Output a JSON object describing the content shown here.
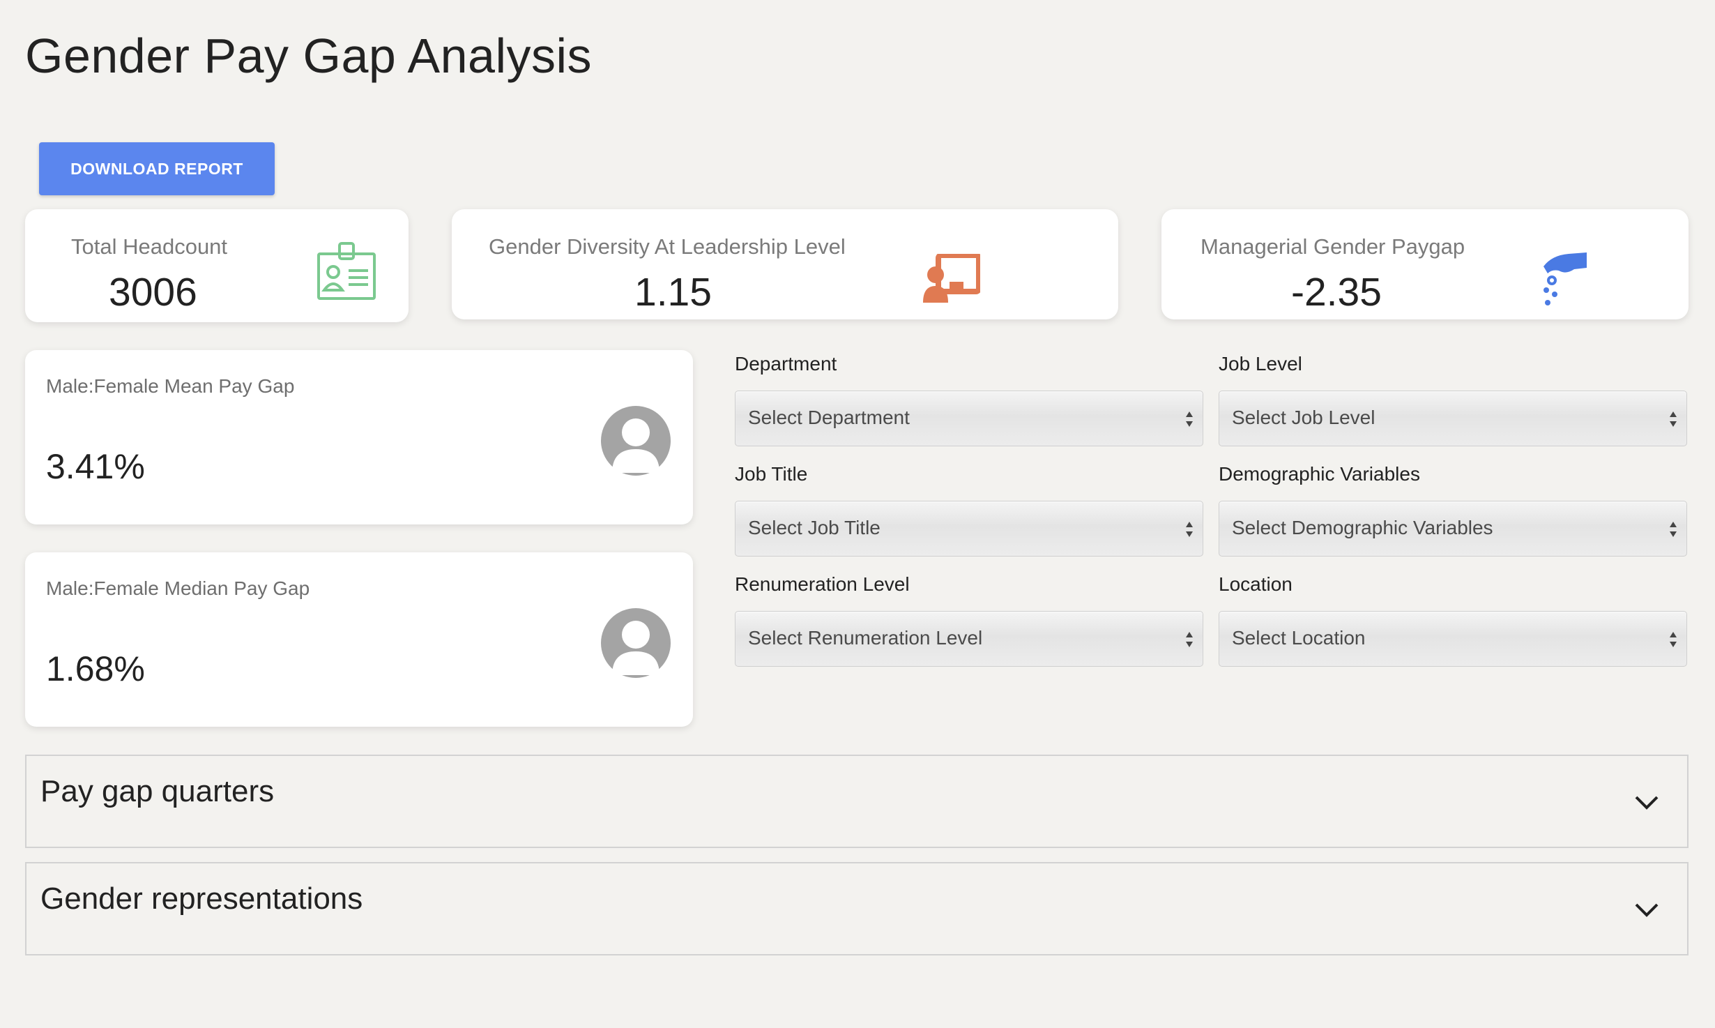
{
  "page_title": "Gender Pay Gap Analysis",
  "download_button": "DOWNLOAD REPORT",
  "stats": {
    "headcount": {
      "label": "Total Headcount",
      "value": "3006",
      "icon": "id-badge-icon",
      "color": "#7bc98f"
    },
    "diversity": {
      "label": "Gender Diversity At Leadership Level",
      "value": "1.15",
      "icon": "presenter-icon",
      "color": "#e07a52"
    },
    "paygap": {
      "label": "Managerial Gender Paygap",
      "value": "-2.35",
      "icon": "hand-coins-icon",
      "color": "#4a7ae3"
    }
  },
  "gap_cards": {
    "mean": {
      "label": "Male:Female Mean Pay Gap",
      "value": "3.41%"
    },
    "median": {
      "label": "Male:Female Median Pay Gap",
      "value": "1.68%"
    }
  },
  "filters": {
    "department": {
      "label": "Department",
      "placeholder": "Select Department"
    },
    "job_level": {
      "label": "Job Level",
      "placeholder": "Select Job Level"
    },
    "job_title": {
      "label": "Job Title",
      "placeholder": "Select Job Title"
    },
    "demographic": {
      "label": "Demographic Variables",
      "placeholder": "Select Demographic Variables"
    },
    "renumeration": {
      "label": "Renumeration Level",
      "placeholder": "Select Renumeration Level"
    },
    "location": {
      "label": "Location",
      "placeholder": "Select Location"
    }
  },
  "accordions": {
    "quarters": "Pay gap quarters",
    "gender": "Gender representations"
  }
}
